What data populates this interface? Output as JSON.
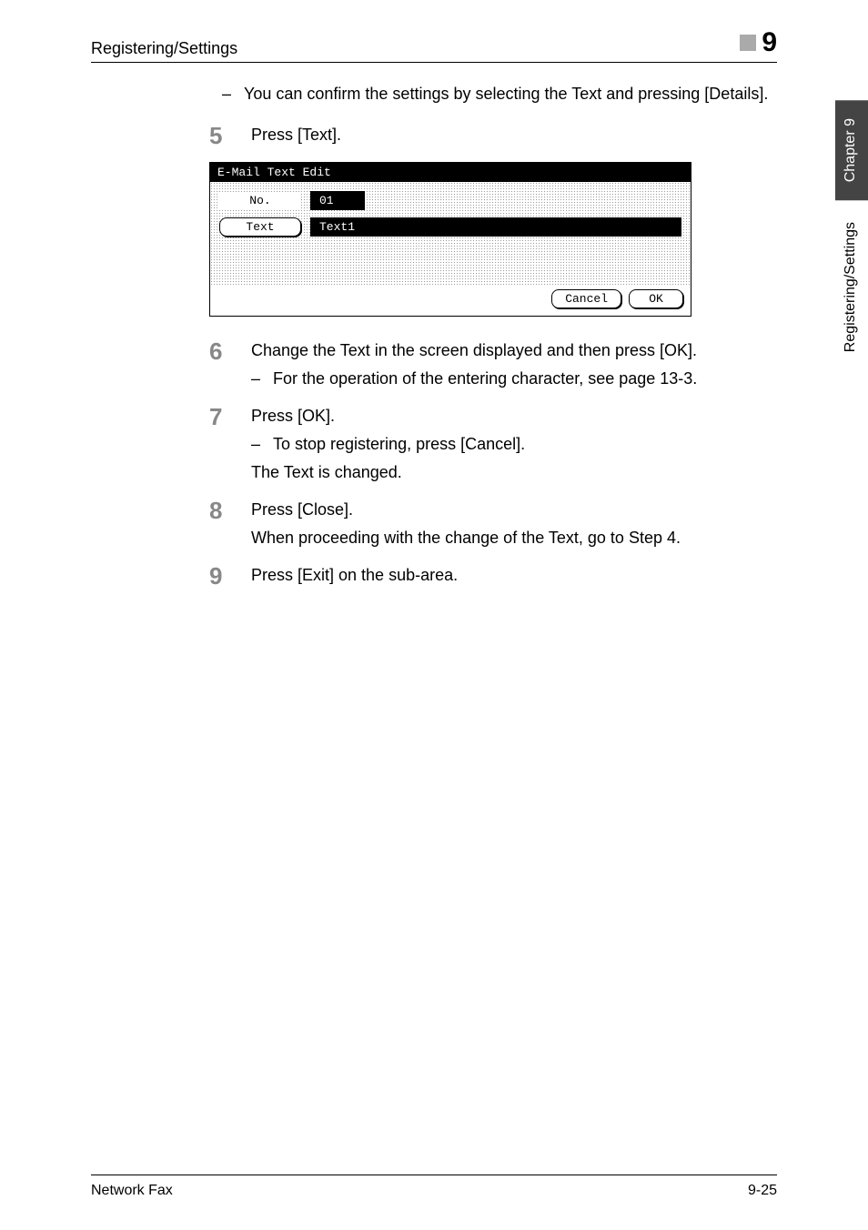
{
  "header": {
    "title": "Registering/Settings",
    "chapter_num": "9"
  },
  "intro_note": "You can confirm the settings by selecting the Text and pressing [Details].",
  "steps": [
    {
      "num": "5",
      "text": "Press [Text]."
    },
    {
      "num": "6",
      "text": "Change the Text in the screen displayed and then press [OK].",
      "sub": "For the operation of the entering character, see page 13-3."
    },
    {
      "num": "7",
      "text": "Press [OK].",
      "sub": "To stop registering, press [Cancel].",
      "cont": "The Text is changed."
    },
    {
      "num": "8",
      "text": "Press [Close].",
      "cont": "When proceeding with the change of the Text, go to Step 4."
    },
    {
      "num": "9",
      "text": "Press [Exit] on the sub-area."
    }
  ],
  "panel": {
    "title": "E-Mail Text Edit",
    "no_label": "No.",
    "no_value": "01",
    "text_label": "Text",
    "text_value": "Text1",
    "cancel_label": "Cancel",
    "ok_label": "OK"
  },
  "side": {
    "chapter": "Chapter 9",
    "section": "Registering/Settings"
  },
  "footer": {
    "left": "Network Fax",
    "right": "9-25"
  }
}
